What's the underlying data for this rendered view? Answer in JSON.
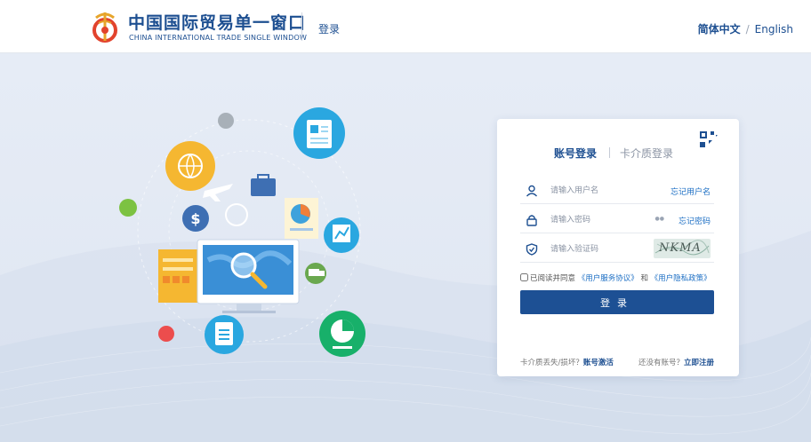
{
  "header": {
    "logo_cn": "中国国际贸易单一窗口",
    "logo_en": "CHINA INTERNATIONAL TRADE SINGLE WINDOW",
    "login": "登录",
    "lang_cn": "简体中文",
    "lang_sep": "/",
    "lang_en": "English"
  },
  "card": {
    "tab_account": "账号登录",
    "tab_card": "卡介质登录",
    "username_placeholder": "请输入用户名",
    "forgot_username": "忘记用户名",
    "password_placeholder": "请输入密码",
    "forgot_password": "忘记密码",
    "captcha_placeholder": "请输入验证码",
    "captcha_text": "NKMA",
    "agree_prefix": "已阅读并同意",
    "service_agreement": "《用户服务协议》",
    "and": "和",
    "privacy_policy": "《用户隐私政策》",
    "login_button": "登录",
    "card_lost_text": "卡介质丢失/损坏？",
    "account_activate": "账号激活",
    "no_account_text": "还没有账号？",
    "register_now": "立即注册"
  },
  "colors": {
    "brand_blue": "#1d4f91",
    "button_blue": "#1d5094",
    "link_blue": "#1d6fc4",
    "background": "#e4eaf4"
  }
}
